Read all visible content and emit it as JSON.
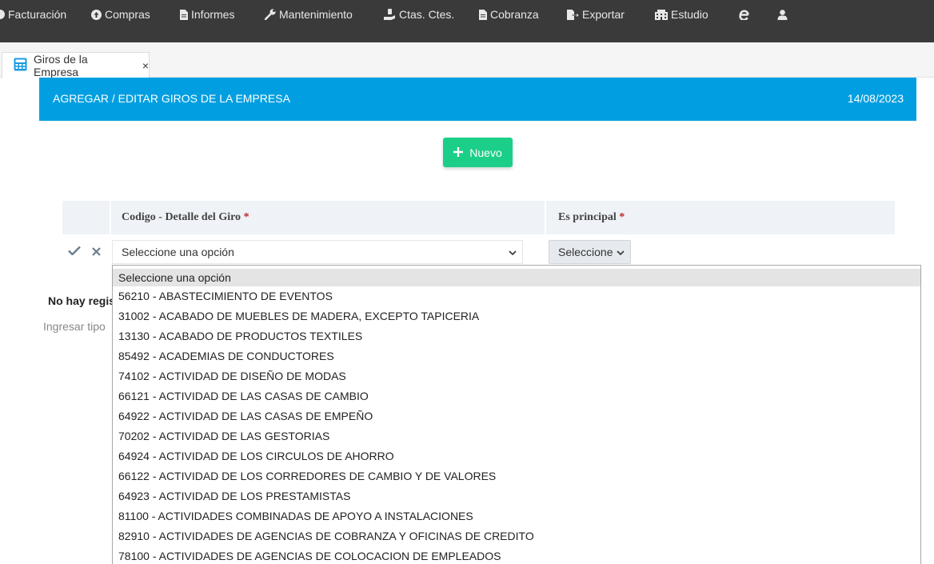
{
  "nav": [
    {
      "label": "Facturación",
      "icon": "circle-icon"
    },
    {
      "label": "Compras",
      "icon": "upload-circle-icon"
    },
    {
      "label": "Informes",
      "icon": "document-icon"
    },
    {
      "label": "Mantenimiento",
      "icon": "wrench-icon"
    },
    {
      "label": "Ctas. Ctes.",
      "icon": "hand-coin-icon"
    },
    {
      "label": "Cobranza",
      "icon": "document-icon"
    },
    {
      "label": "Exportar",
      "icon": "export-icon"
    },
    {
      "label": "Estudio",
      "icon": "building-icon"
    }
  ],
  "tab": {
    "label": "Giros de la Empresa",
    "close": "×"
  },
  "panel": {
    "title": "AGREGAR / EDITAR GIROS DE LA EMPRESA",
    "date": "14/08/2023"
  },
  "buttons": {
    "nuevo": "Nuevo"
  },
  "table": {
    "col_giro": "Codigo - Detalle del Giro",
    "col_principal": "Es principal",
    "required_mark": "*"
  },
  "row": {
    "giro_value": "Seleccione una opción",
    "principal_value": "Seleccione"
  },
  "empty": {
    "message": "No hay regis",
    "hint": "Ingresar tipo"
  },
  "dropdown": {
    "options": [
      "Seleccione una opción",
      "56210 - ABASTECIMIENTO DE EVENTOS",
      "31002 - ACABADO DE MUEBLES DE MADERA, EXCEPTO TAPICERIA",
      "13130 - ACABADO DE PRODUCTOS TEXTILES",
      "85492 - ACADEMIAS DE CONDUCTORES",
      "74102 - ACTIVIDAD DE DISEÑO DE MODAS",
      "66121 - ACTIVIDAD DE LAS CASAS DE CAMBIO",
      "64922 - ACTIVIDAD DE LAS CASAS DE EMPEÑO",
      "70202 - ACTIVIDAD DE LAS GESTORIAS",
      "64924 - ACTIVIDAD DE LOS CIRCULOS DE AHORRO",
      "66122 - ACTIVIDAD DE LOS CORREDORES DE CAMBIO Y DE VALORES",
      "64923 - ACTIVIDAD DE LOS PRESTAMISTAS",
      "81100 - ACTIVIDADES COMBINADAS DE APOYO A INSTALACIONES",
      "82910 - ACTIVIDADES DE AGENCIAS DE COBRANZA Y OFICINAS DE CREDITO",
      "78100 - ACTIVIDADES DE AGENCIAS DE COLOCACION DE EMPLEADOS"
    ],
    "selected_index": 0
  },
  "colors": {
    "nav_bg": "#3a3a3a",
    "header_bg": "#019fe1",
    "button_bg": "#1ccf88",
    "required": "#c0282d"
  }
}
